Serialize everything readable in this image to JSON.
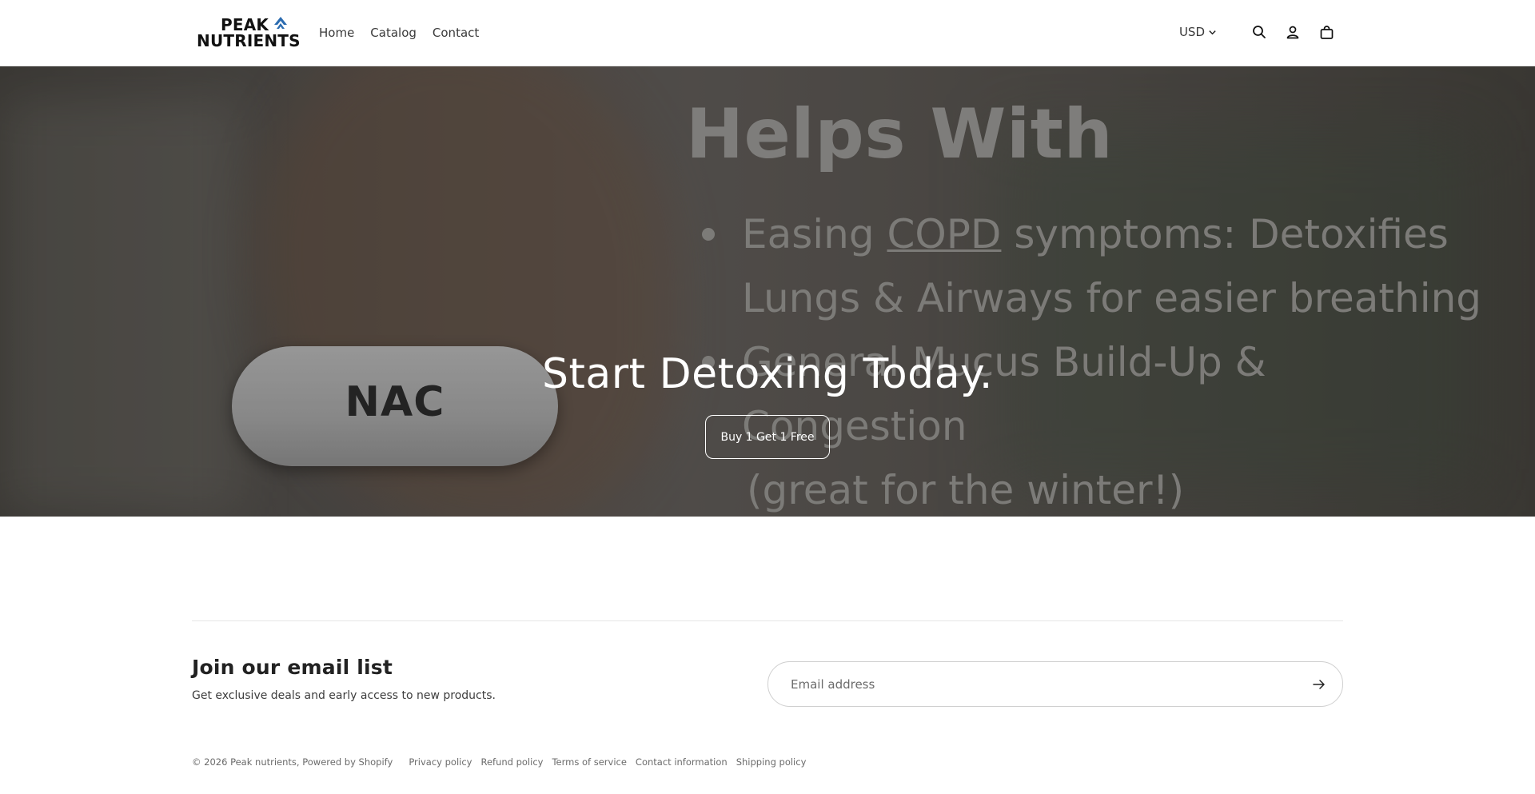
{
  "brand": {
    "logo_line1": "PEAK",
    "logo_line2": "NUTRIENTS",
    "accent_color": "#2b6cb0"
  },
  "nav": {
    "items": [
      {
        "label": "Home"
      },
      {
        "label": "Catalog"
      },
      {
        "label": "Contact"
      }
    ]
  },
  "header_actions": {
    "currency": "USD",
    "icons": [
      "search-icon",
      "account-icon",
      "cart-icon",
      "chevron-down-icon"
    ]
  },
  "hero": {
    "image_heading": "Helps With",
    "image_bullet1_a": "Easing ",
    "image_bullet1_link": "COPD",
    "image_bullet1_b": " symptoms: Detoxifies",
    "image_bullet1_line2": "Lungs & Airways for easier breathing",
    "image_bullet2_line1": "General Mucus Build-Up &",
    "image_bullet2_line2": "Congestion",
    "image_bullet2_line3": "(great for the winter!)",
    "pill_label": "NAC",
    "title": "Start Detoxing Today.",
    "button_label": "Buy 1 Get 1 Free"
  },
  "newsletter": {
    "title": "Join our email list",
    "subtitle": "Get exclusive deals and early access to new products.",
    "email_placeholder": "Email address",
    "submit_icon": "arrow-right-icon"
  },
  "footer": {
    "copyright": "© 2026 Peak nutrients, Powered by Shopify",
    "policies": [
      {
        "label": "Privacy policy"
      },
      {
        "label": "Refund policy"
      },
      {
        "label": "Terms of service"
      },
      {
        "label": "Contact information"
      },
      {
        "label": "Shipping policy"
      }
    ]
  }
}
